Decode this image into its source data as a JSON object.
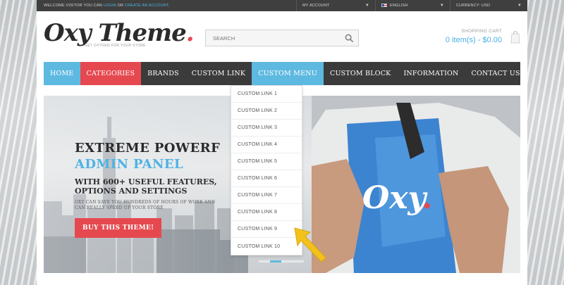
{
  "topbar": {
    "welcome_prefix": "WELCOME VISITOR YOU CAN",
    "login": "LOGIN",
    "or": "OR",
    "create_account": "CREATE AN ACCOUNT",
    "period": ".",
    "account": "MY ACCOUNT",
    "language": "ENGLISH",
    "currency": "CURRENCY: USD"
  },
  "logo": {
    "name": "Oxy Theme",
    "dot": ".",
    "tagline": "GET OXYGEN FOR YOUR STORE"
  },
  "search": {
    "placeholder": "SEARCH"
  },
  "cart": {
    "title": "SHOPPING CART",
    "summary": "0 item(s) - $0.00"
  },
  "nav": {
    "home": "HOME",
    "categories": "CATEGORIES",
    "brands": "BRANDS",
    "custom_link": "CUSTOM LINK",
    "custom_menu": "CUSTOM MENU",
    "custom_block": "CUSTOM BLOCK",
    "information": "INFORMATION",
    "contact_us": "CONTACT US"
  },
  "dropdown": {
    "items": [
      "CUSTOM LINK 1",
      "CUSTOM LINK 2",
      "CUSTOM LINK 3",
      "CUSTOM LINK 4",
      "CUSTOM LINK 5",
      "CUSTOM LINK 6",
      "CUSTOM LINK 7",
      "CUSTOM LINK 8",
      "CUSTOM LINK 9",
      "CUSTOM LINK 10"
    ]
  },
  "hero": {
    "line1": "EXTREME POWERF",
    "line2": "ADMIN PANEL",
    "line3": "WITH 600+ USEFUL FEATURES, OPTIONS AND SETTINGS",
    "paragraph": "OXY CAN SAVE YOU HUNDREDS OF HOURS OF WORK AND CAN REALLY SPEED UP YOUR STORE",
    "button": "BUY THIS THEME!",
    "shirt_logo": "Oxy",
    "shirt_dot": "."
  },
  "colors": {
    "accent_blue": "#5eb9e1",
    "accent_red": "#e5494f",
    "nav_dark": "#3b3b3b",
    "arrow_yellow": "#f2c21b"
  },
  "icons": [
    "search-icon",
    "shopping-bag-icon",
    "flag-icon",
    "chevron-down-icon",
    "pointer-arrow-icon"
  ]
}
